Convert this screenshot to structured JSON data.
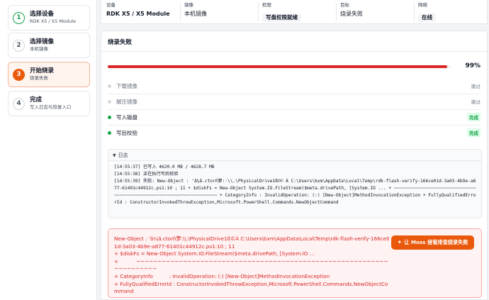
{
  "sidebar": {
    "steps": [
      {
        "number": "1",
        "title": "选择设备",
        "subtitle": "RDK X5 / X5 Module",
        "state": "done"
      },
      {
        "number": "2",
        "title": "选择镜像",
        "subtitle": "本机镜像",
        "state": "pending"
      },
      {
        "number": "3",
        "title": "开始烧录",
        "subtitle": "烧录失败",
        "state": "current"
      },
      {
        "number": "4",
        "title": "完成",
        "subtitle": "写入日志与恢复入口",
        "state": "pending"
      }
    ]
  },
  "infobar": {
    "device_label": "设备",
    "device_value": "RDK X5 / X5 Module",
    "image_label": "镜像",
    "image_value": "本机镜像",
    "permission_label": "权限",
    "permission_value": "写盘权限就绪",
    "target_label": "目标",
    "target_value": "烧录失败",
    "network_label": "网络",
    "network_value": "在线"
  },
  "panel": {
    "title": "烧录失败",
    "progress_percent": 99,
    "progress_text": "99%",
    "stages": [
      {
        "label": "下载镜像",
        "status": "跳过",
        "state": "skipped"
      },
      {
        "label": "解压镜像",
        "status": "跳过",
        "state": "skipped"
      },
      {
        "label": "写入磁盘",
        "status": "完成",
        "state": "done"
      },
      {
        "label": "写后校验",
        "status": "完成",
        "state": "done"
      }
    ],
    "log_title": "日志",
    "log_text": "[14:55:37] 已写入 4620.0 MB / 4628.7 MB\n[14:55:38] 正在执行写后校验\n[14:55:39] 失败: New-Object : 'â¼ã.ctorñ箩:·\\\\.\\PhysicalDrive1ß©© À C:\\Users\\bxm\\AppData\\Local\\Temp\\rdk-flash-verify-166ce01d-3a03-4b9e-a877-61401c44912c.ps1:10 ; 11 + $diskFs = New-Object System.IO.FileStream($meta.drivePath, [System.IO ... + ~~~~~~~~~~~~~~~~~~~~~~~~~~~~~~~~~~~~~~~~~~~~~~~~~~~~~~~~~~~~~~~~~~~~~~ + CategoryInfo : InvalidOperation: (:) [New-Object]MethodInvocationException + FullyQualifiedErrorId : ConstructorInvokedThrowException,Microsoft.PowerShell.Commands.NewObjectCommand",
    "error_text": "New-Object : 'â¼ã.ctorñ箩:\\\\.\\PhysicalDrive1ß©À C:\\Users\\bxm\\AppData\\Local\\Temp\\rdk-flash-verify-166ce01d-3a03-4b9e-a877-61401c44912c.ps1:10 ; 11\n+ $diskFs = New-Object System.IO.FileStream($meta.drivePath, [System.IO ...\n+           ~~~~~~~~~~~~~~~~~~~~~~~~~~~~~~~~~~~~~~~~~~~~~~~~~~~~~~~~~~~~~~~~~~~~~\n+ CategoryInfo          : InvalidOperation: (:) [New-Object]MethodInvocationException\n+ FullyQualifiedErrorId : ConstructorInvokedThrowException,Microsoft.PowerShell.Commands.NewObjectCommand",
    "error_button_label": "让 Moss 接管排查烧录失败"
  },
  "colors": {
    "accent": "#ea580c",
    "error": "#dc2626",
    "success": "#16a34a"
  },
  "icons": {
    "error_button": "wand-icon",
    "log_toggle": "caret-down-icon"
  }
}
